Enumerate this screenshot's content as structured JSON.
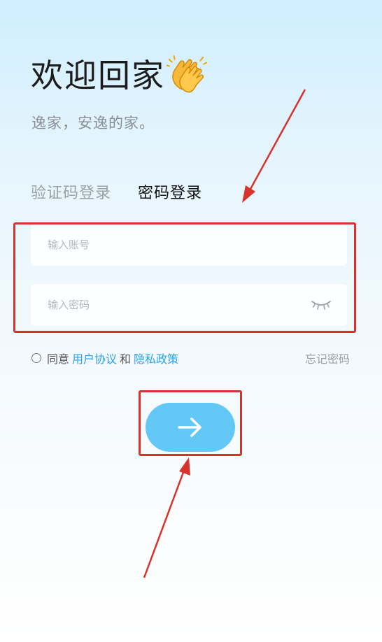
{
  "header": {
    "title": "欢迎回家",
    "subtitle": "逸家，安逸的家。",
    "title_icon": "clapping-hands-emoji"
  },
  "tabs": [
    {
      "label": "验证码登录",
      "active": false
    },
    {
      "label": "密码登录",
      "active": true
    }
  ],
  "form": {
    "account_placeholder": "输入账号",
    "account_value": "",
    "password_placeholder": "输入密码",
    "password_value": "",
    "password_toggle_icon": "eye-closed-icon"
  },
  "agreement": {
    "checked": false,
    "prefix": "同意",
    "user_agreement": "用户协议",
    "conjunction": "和",
    "privacy_policy": "隐私政策"
  },
  "forgot_password": "忘记密码",
  "submit": {
    "icon": "arrow-right-icon"
  },
  "colors": {
    "accent": "#2aa2e8",
    "button": "#64c8f7",
    "annotation": "#d6332c",
    "title": "#1c1c1c",
    "muted": "#9aa1a7"
  }
}
